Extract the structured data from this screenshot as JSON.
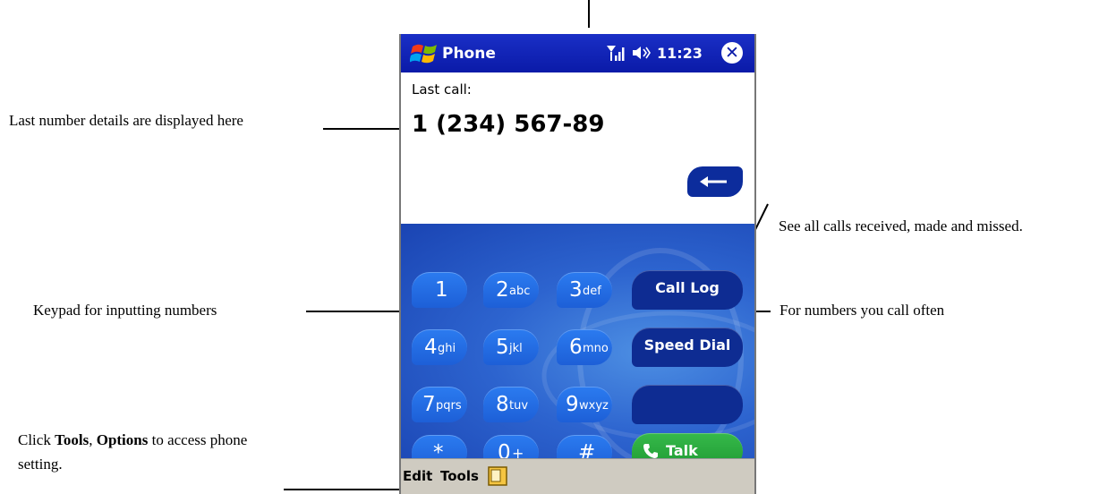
{
  "annotations": {
    "last_number": "Last number details are displayed here",
    "keypad": "Keypad for inputting numbers",
    "tools_prefix": "Click ",
    "tools_word": "Tools",
    "tools_sep": ", ",
    "options_word": "Options",
    "tools_suffix": " to access phone setting.",
    "call_log": "See all calls received, made and missed.",
    "speed_dial": "For numbers you call often"
  },
  "titlebar": {
    "app_title": "Phone",
    "time": "11:23",
    "close_glyph": "✕",
    "icons": [
      "windows-start-icon",
      "signal-strength-icon",
      "volume-icon",
      "close-icon"
    ]
  },
  "display": {
    "label": "Last call:",
    "number": "1 (234) 567-89"
  },
  "keypad": {
    "keys": [
      {
        "digit": "1",
        "letters": ""
      },
      {
        "digit": "2",
        "letters": "abc"
      },
      {
        "digit": "3",
        "letters": "def"
      },
      {
        "digit": "4",
        "letters": "ghi"
      },
      {
        "digit": "5",
        "letters": "jkl"
      },
      {
        "digit": "6",
        "letters": "mno"
      },
      {
        "digit": "7",
        "letters": "pqrs"
      },
      {
        "digit": "8",
        "letters": "tuv"
      },
      {
        "digit": "9",
        "letters": "wxyz"
      },
      {
        "digit": "*",
        "letters": ""
      },
      {
        "digit": "0",
        "letters": "+"
      },
      {
        "digit": "#",
        "letters": ""
      }
    ],
    "call_log": "Call Log",
    "speed_dial": "Speed Dial",
    "talk": "Talk"
  },
  "menubar": {
    "edit": "Edit",
    "tools": "Tools"
  },
  "colors": {
    "title_blue": "#0a1aa8",
    "key_blue": "#1d5fd7",
    "key_dark": "#0e2c92",
    "talk_green": "#1f9a33",
    "menubar_gray": "#cfcbc1"
  }
}
